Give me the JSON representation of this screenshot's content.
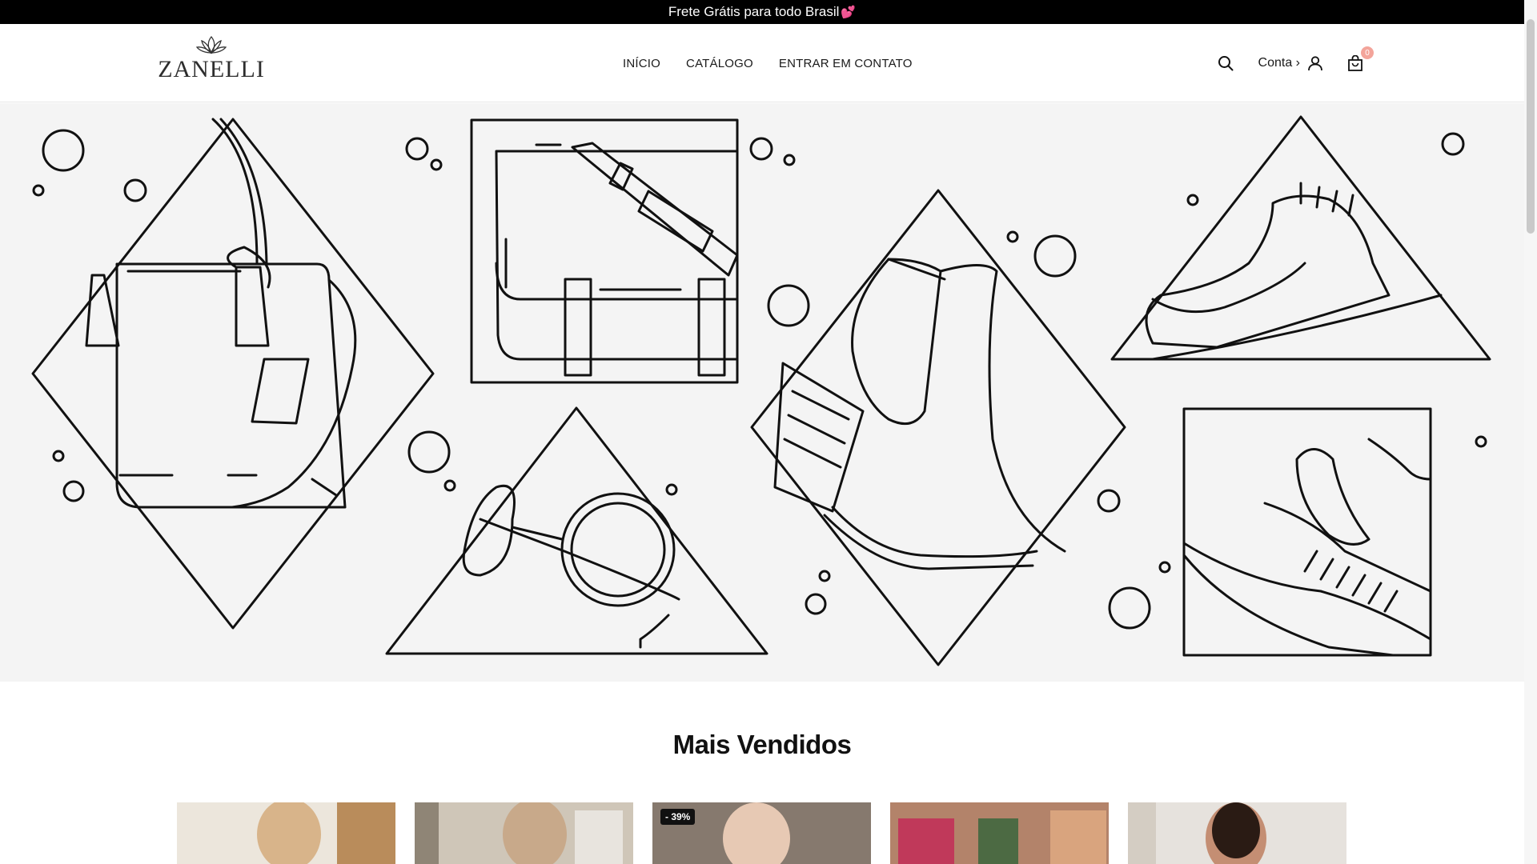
{
  "announcement": {
    "text": "Frete Grátis para todo Brasil",
    "emoji": "💕"
  },
  "brand": {
    "name": "ZANELLI"
  },
  "nav": {
    "items": [
      "INÍCIO",
      "CATÁLOGO",
      "ENTRAR EM CONTATO"
    ]
  },
  "header_tools": {
    "account_label": "Conta ›",
    "cart_count": "0"
  },
  "hero": {
    "illustration": "accessories line art: handbag, messenger bag, heeled boot, oxford shoe, sunglasses, hat with feather"
  },
  "section": {
    "title": "Mais Vendidos"
  },
  "products": [
    {
      "badge": "",
      "bg": "#d9c7ae"
    },
    {
      "badge": "",
      "bg": "#bfb5a5"
    },
    {
      "badge": "- 39%",
      "bg": "#8a7f76"
    },
    {
      "badge": "",
      "bg": "#b89278"
    },
    {
      "badge": "",
      "bg": "#e4e0db"
    }
  ],
  "colors": {
    "announcement_bg": "#000000",
    "hero_bg": "#f4f4f4",
    "cart_badge": "#f3a49a"
  }
}
